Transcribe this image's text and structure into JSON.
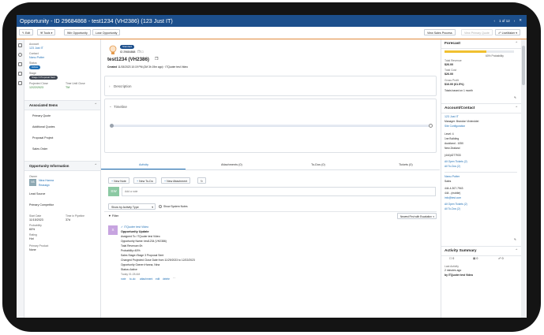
{
  "header": {
    "title": "Opportunity - ID 29684868 - test1234 (VH2386) (123 Just IT)",
    "pager": "1 of 12"
  },
  "toolbar": {
    "edit": "Edit",
    "tools": "Tools",
    "win": "Win Opportunity",
    "lose": "Lose Opportunity",
    "view_sales_process": "View Sales Process",
    "view_primary_quote": "View Primary Quote",
    "linkmaker": "LiveMaker"
  },
  "left": {
    "account_label": "Account",
    "account": "123 Just IT",
    "contact_label": "Contact",
    "contact": "Nanu Potter",
    "status_label": "Status",
    "status": "Active",
    "stage_label": "Stage",
    "stage": "Stage 3 Proposal Sent",
    "proj_close_label": "Projected Close",
    "proj_close": "12/22/2023",
    "time_label": "Time Until Close",
    "time": "TM",
    "assoc_title": "Associated Items",
    "assoc_items": [
      "Primary Quote",
      "Additional Quotes",
      "Proposal Project",
      "Sales Order"
    ],
    "info_title": "Opportunity Information",
    "owner_label": "Owner",
    "owner_initials": "NS",
    "owner_name": "Nina Hanna",
    "owner_link": "Reassign",
    "lead_source": "Lead Source",
    "primary_competitor": "Primary Competitor",
    "start_label": "Start Date",
    "start": "11/15/2023",
    "pipeline_label": "Time in Pipeline",
    "pipeline": "37d",
    "probability_label": "Probability",
    "probability": "60%",
    "rating_label": "Rating",
    "rating": "Hot",
    "product_label": "Primary Product",
    "product": "None"
  },
  "center": {
    "badge": "Standard",
    "opp_id": "ID 29684868",
    "name": "test1234 (VH2386)",
    "created_label": "Created",
    "created": "11/15/2023 10:19 PM (2M 3h 19m ago) · ITQuoter test Video",
    "description": "Description",
    "timeline": "Timeline",
    "tabs": [
      "Activity",
      "Attachments (0)",
      "To-Dos (0)",
      "Tickets (0)"
    ],
    "new_note": "New Note",
    "new_todo": "New To-Do",
    "new_attachment": "New Attachment",
    "add_note_initials": "SW",
    "add_note_placeholder": "Add a note",
    "show_by": "Show by Activity Type",
    "show_system": "Show System Notes",
    "filter": "Filter",
    "sort": "Newest First with Escalation",
    "entry_initials": "X",
    "entry_author": "ITQuoter test Video",
    "entry_title": "Opportunity Update",
    "entry_lines": [
      "Assigned To: ITQuoter test Video",
      "Opportunity Name: test1234 (VH2386)",
      "Total Revenue=0h",
      "Probability=60%",
      "Sales Stage=Stage 3 Proposal Sent",
      "Changed Projected Close Date from 11/29/2023 to 12/22/2023",
      "Opportunity Owner=Hanna, Nina",
      "Status=Active",
      "Today 01:28 AM"
    ],
    "entry_actions": [
      "note",
      "to-do",
      "attachment",
      "edit",
      "delete"
    ]
  },
  "right": {
    "forecast_title": "Forecast",
    "probability_text": "60% Probability",
    "probability_fraction": 0.6,
    "total_revenue_label": "Total Revenue",
    "total_revenue": "$26.00",
    "total_cost_label": "Total Cost",
    "total_cost": "$26.00",
    "gross_profit_label": "Gross Profit",
    "gross_profit": "$16.00 (61.5%)",
    "totals_note": "Totals based on 1 month",
    "account_title": "Account/Contact",
    "account_name": "123 Just IT",
    "account_manager": "Manager: Brandon Vivienddei",
    "site_config": "Site Configuration",
    "level": "Level: 4",
    "address": [
      "1ne Building",
      "Auckland - 1050",
      "New Zealand"
    ],
    "phone": "(444)4277933",
    "account_tickets": "All Open Tickets (2)",
    "account_todos": "All To-Dos (2)",
    "contact_name": "Nanu Potter",
    "contact_role": "Sales",
    "contact_phone": "444-4-307-7943",
    "contact_mobile": "444 - (mobile)",
    "contact_email": "info@test.com",
    "contact_tickets": "All Open Tickets (2)",
    "contact_todos": "All To-Dos (2)",
    "activity_title": "Activity Summary",
    "counts": [
      "0",
      "0",
      "0"
    ],
    "last_activity_label": "Last Activity",
    "last_activity_time": "2 minutes ago",
    "last_activity_by": "by ITQuoter test Video"
  }
}
